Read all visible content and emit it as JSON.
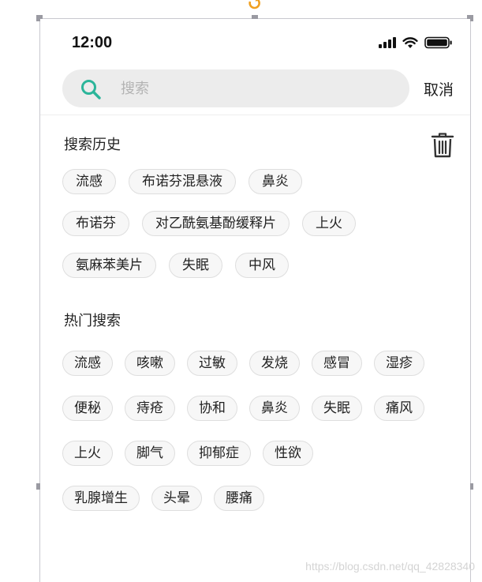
{
  "status_bar": {
    "time": "12:00",
    "icons": [
      "signal-icon",
      "wifi-icon",
      "battery-icon"
    ]
  },
  "search": {
    "placeholder": "搜索",
    "value": "",
    "cancel_label": "取消",
    "icon": "search-icon",
    "accent_color": "#2bb59a"
  },
  "history": {
    "title": "搜索历史",
    "clear_icon": "trash-icon",
    "rows": [
      [
        "流感",
        "布诺芬混悬液",
        "鼻炎"
      ],
      [
        "布诺芬",
        "对乙酰氨基酚缓释片",
        "上火"
      ],
      [
        "氨麻苯美片",
        "失眠",
        "中风"
      ]
    ]
  },
  "hot": {
    "title": "热门搜索",
    "rows": [
      [
        "流感",
        "咳嗽",
        "过敏",
        "发烧",
        "感冒",
        "湿疹"
      ],
      [
        "便秘",
        "痔疮",
        "协和",
        "鼻炎",
        "失眠",
        "痛风"
      ],
      [
        "上火",
        "脚气",
        "抑郁症",
        "性欲"
      ],
      [
        "乳腺增生",
        "头晕",
        "腰痛"
      ]
    ]
  },
  "watermark": "https://blog.csdn.net/qq_42828340"
}
